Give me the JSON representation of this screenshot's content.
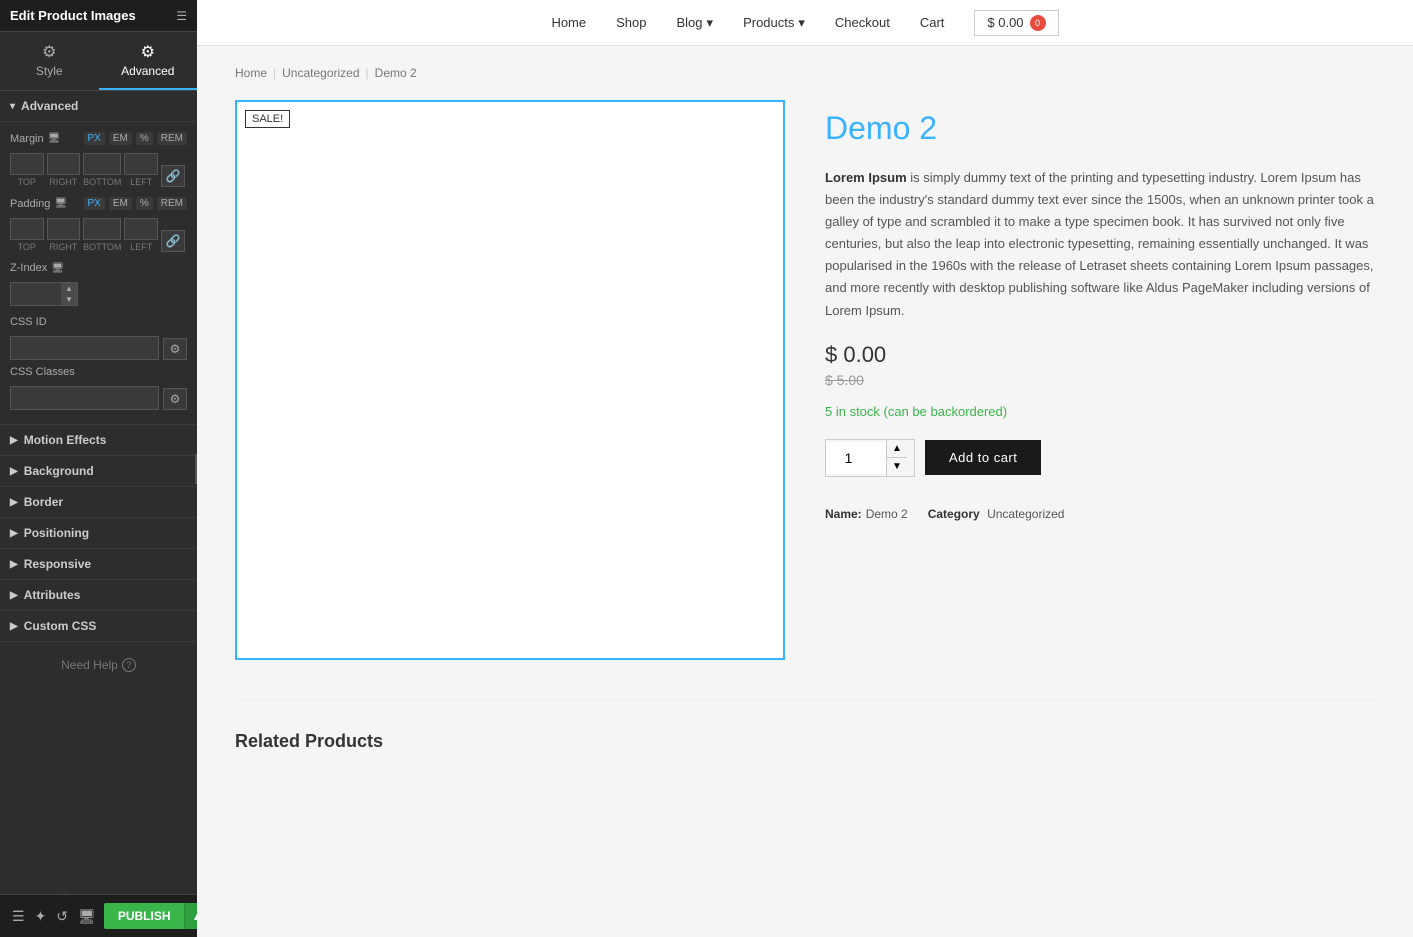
{
  "panel": {
    "title": "Edit Product Images",
    "tabs": [
      {
        "id": "style",
        "label": "Style",
        "icon": "⚙"
      },
      {
        "id": "advanced",
        "label": "Advanced",
        "icon": "⚙"
      }
    ],
    "active_tab": "advanced",
    "sections": {
      "advanced": {
        "label": "Advanced",
        "margin": {
          "label": "Margin",
          "top": "",
          "right": "",
          "bottom": "",
          "left": "",
          "units": [
            "PX",
            "EM",
            "%",
            "REM"
          ]
        },
        "padding": {
          "label": "Padding",
          "top": "",
          "right": "",
          "bottom": "",
          "left": "",
          "units": [
            "PX",
            "EM",
            "%",
            "REM"
          ]
        },
        "zindex": {
          "label": "Z-Index",
          "value": ""
        },
        "css_id": {
          "label": "CSS ID",
          "value": ""
        },
        "css_classes": {
          "label": "CSS Classes",
          "value": ""
        }
      }
    },
    "collapsible_sections": [
      "Motion Effects",
      "Background",
      "Border",
      "Positioning",
      "Responsive",
      "Attributes",
      "Custom CSS"
    ],
    "need_help": "Need Help",
    "publish_btn": "PUBLISH"
  },
  "nav": {
    "items": [
      {
        "label": "Home"
      },
      {
        "label": "Shop"
      },
      {
        "label": "Blog",
        "has_dropdown": true
      },
      {
        "label": "Products",
        "has_dropdown": true
      },
      {
        "label": "Checkout"
      },
      {
        "label": "Cart"
      }
    ],
    "cart": {
      "label": "$ 0.00",
      "badge": "0"
    }
  },
  "breadcrumb": {
    "items": [
      "Home",
      "Uncategorized",
      "Demo 2"
    ]
  },
  "product": {
    "title": "Demo 2",
    "sale_badge": "SALE!",
    "description_bold": "Lorem Ipsum",
    "description": " is simply dummy text of the printing and typesetting industry. Lorem Ipsum has been the industry's standard dummy text ever since the 1500s, when an unknown printer took a galley of type and scrambled it to make a type specimen book. It has survived not only five centuries, but also the leap into electronic typesetting, remaining essentially unchanged. It was popularised in the 1960s with the release of Letraset sheets containing Lorem Ipsum passages, and more recently with desktop publishing software like Aldus PageMaker including versions of Lorem Ipsum.",
    "current_price": "$ 0.00",
    "original_price": "$ 5.00",
    "stock": "5 in stock (can be backordered)",
    "quantity": "1",
    "add_to_cart_btn": "Add to cart",
    "meta_name": "Demo 2",
    "meta_name_label": "Name:",
    "meta_category": "Uncategorized",
    "meta_category_label": "Category"
  },
  "related_products": {
    "title": "Related Products"
  }
}
